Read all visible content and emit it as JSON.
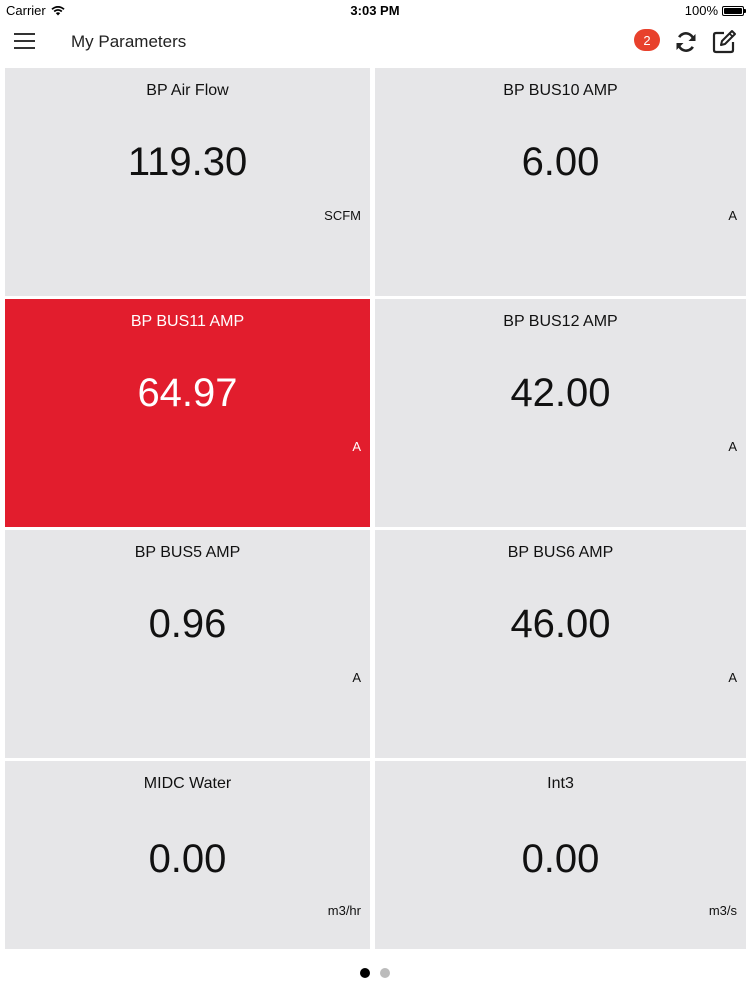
{
  "status_bar": {
    "carrier": "Carrier",
    "wifi_icon": "wifi-icon",
    "time": "3:03 PM",
    "battery": "100%",
    "battery_icon": "battery-icon"
  },
  "nav": {
    "menu_icon": "hamburger-menu-icon",
    "title": "My Parameters",
    "notification_count": "2",
    "refresh_icon": "refresh-icon",
    "edit_icon": "edit-icon"
  },
  "tiles": [
    {
      "name": "BP Air Flow",
      "value": "119.30",
      "unit": "SCFM",
      "alert": false
    },
    {
      "name": "BP BUS10 AMP",
      "value": "6.00",
      "unit": "A",
      "alert": false
    },
    {
      "name": "BP BUS11 AMP",
      "value": "64.97",
      "unit": "A",
      "alert": true
    },
    {
      "name": "BP BUS12 AMP",
      "value": "42.00",
      "unit": "A",
      "alert": false
    },
    {
      "name": "BP BUS5 AMP",
      "value": "0.96",
      "unit": "A",
      "alert": false
    },
    {
      "name": "BP BUS6 AMP",
      "value": "46.00",
      "unit": "A",
      "alert": false
    },
    {
      "name": "MIDC Water",
      "value": "0.00",
      "unit": "m3/hr",
      "alert": false
    },
    {
      "name": "Int3",
      "value": "0.00",
      "unit": "m3/s",
      "alert": false
    }
  ],
  "colors": {
    "alert_tile": "#e21d2d",
    "normal_tile": "#e6e6e8",
    "badge": "#e8412c"
  },
  "pager": {
    "pages": 2,
    "current": 1
  }
}
